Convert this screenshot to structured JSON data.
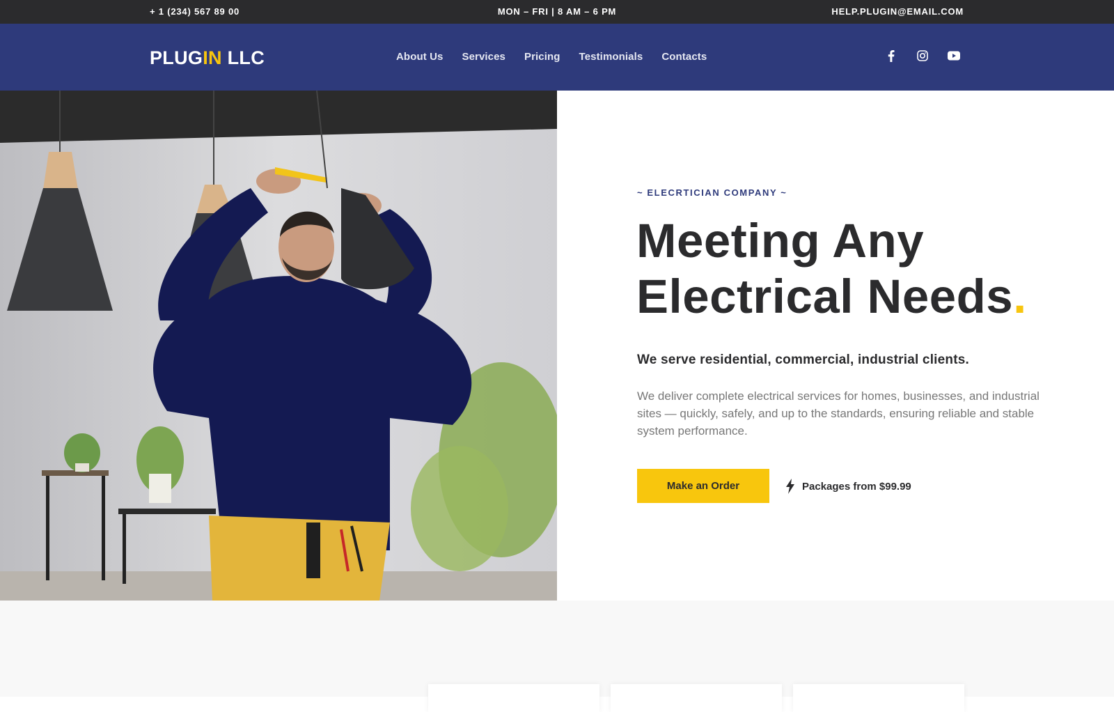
{
  "topbar": {
    "phone": "+ 1 (234) 567 89 00",
    "hours": "MON – FRI | 8 AM – 6 PM",
    "email": "HELP.PLUGIN@EMAIL.COM"
  },
  "header": {
    "logo_part1": "PLUG",
    "logo_part2": "IN",
    "logo_part3": " LLC",
    "nav": [
      "About Us",
      "Services",
      "Pricing",
      "Testimonials",
      "Contacts"
    ],
    "social_icons": [
      "facebook-icon",
      "instagram-icon",
      "youtube-icon"
    ]
  },
  "hero": {
    "eyebrow": "~ ELECRTICIAN COMPANY ~",
    "headline_line1": "Meeting Any",
    "headline_line2": "Electrical Needs",
    "headline_dot": ".",
    "subheading": "We serve residential, commercial, industrial clients.",
    "paragraph": "We deliver complete electrical services for homes, businesses, and industrial sites — quickly, safely, and up to the standards, ensuring reliable and stable system performance.",
    "cta_label": "Make an Order",
    "packages_label": "Packages from $99.99",
    "packages_icon": "lightning-bolt-icon",
    "image": "electrician-installing-pendant-lamp-photo"
  },
  "colors": {
    "topbar_bg": "#2b2b2d",
    "nav_bg": "#2e3a7b",
    "accent_yellow": "#f8c60d",
    "text_dark": "#2b2b2d",
    "text_muted": "#777777"
  }
}
